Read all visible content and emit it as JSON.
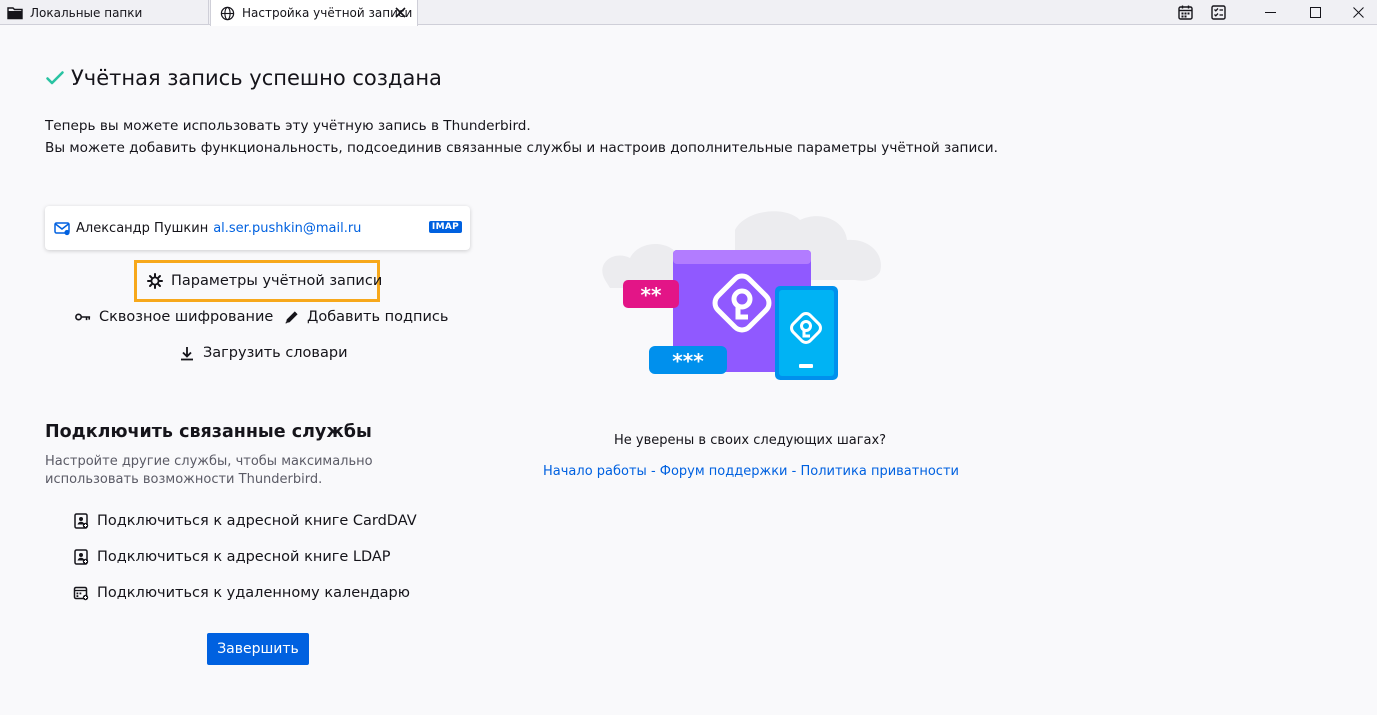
{
  "tabs": [
    {
      "label": "Локальные папки",
      "icon": "folder-icon"
    },
    {
      "label": "Настройка учётной записи",
      "icon": "globe-icon",
      "active": true
    }
  ],
  "toolbar": {
    "icons": [
      "calendar-icon",
      "tasks-icon"
    ]
  },
  "window_controls": [
    "minimize-icon",
    "maximize-icon",
    "close-icon"
  ],
  "header": {
    "title": "Учётная запись успешно создана",
    "line1": "Теперь вы можете использовать эту учётную запись в Thunderbird.",
    "line2": "Вы можете добавить функциональность, подсоединив связанные службы и настроив дополнительные параметры учётной записи."
  },
  "account": {
    "name": "Александр Пушкин",
    "email": "al.ser.pushkin@mail.ru",
    "badge": "IMAP"
  },
  "actions": {
    "settings": "Параметры учётной записи",
    "e2e": "Сквозное шифрование",
    "signature": "Добавить подпись",
    "dictionaries": "Загрузить словари"
  },
  "services": {
    "title": "Подключить связанные службы",
    "description": "Настройте другие службы, чтобы максимально использовать возможности Thunderbird.",
    "carddav": "Подключиться к адресной книге CardDAV",
    "ldap": "Подключиться к адресной книге LDAP",
    "calendar": "Подключиться к удаленному календарю"
  },
  "finish_button": "Завершить",
  "help": {
    "question": "Не уверены в своих следующих шагах?",
    "link1": "Начало работы",
    "link2": "Форум поддержки",
    "link3": "Политика приватности",
    "separator": " - "
  },
  "illustration": {
    "password_short": "**",
    "password_long": "***"
  },
  "colors": {
    "accent": "#0061e0",
    "success": "#2ac3a2",
    "highlight": "#f7a81b",
    "purple": "#9059ff",
    "blue": "#0090ed",
    "pink": "#e31587"
  }
}
